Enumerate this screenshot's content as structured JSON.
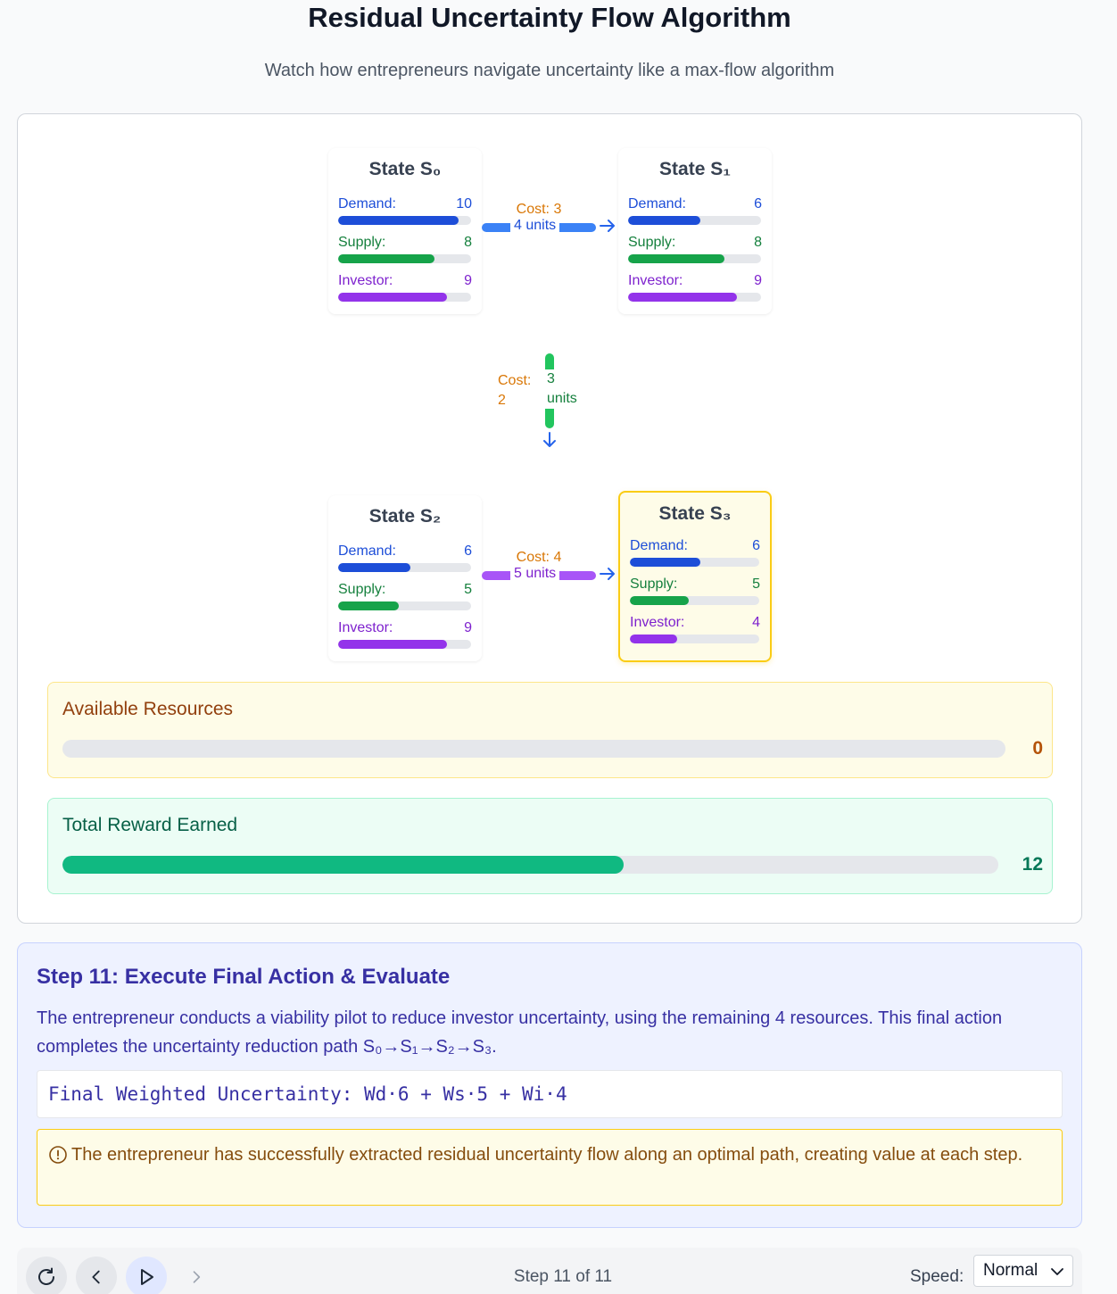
{
  "header": {
    "title": "Residual Uncertainty Flow Algorithm",
    "subtitle": "Watch how entrepreneurs navigate uncertainty like a max-flow algorithm"
  },
  "colors": {
    "demand": "#1d4ed8",
    "supply": "#16a34a",
    "investor": "#9333ea",
    "cost": "#d97706",
    "highlight": "#facc15",
    "reward": "#10b981"
  },
  "metric_max": 11,
  "states": [
    {
      "title": "State S₀",
      "demand_label": "Demand:",
      "demand": 10,
      "supply_label": "Supply:",
      "supply": 8,
      "investor_label": "Investor:",
      "investor": 9,
      "highlighted": false
    },
    {
      "title": "State S₁",
      "demand_label": "Demand:",
      "demand": 6,
      "supply_label": "Supply:",
      "supply": 8,
      "investor_label": "Investor:",
      "investor": 9,
      "highlighted": false
    },
    {
      "title": "State S₂",
      "demand_label": "Demand:",
      "demand": 6,
      "supply_label": "Supply:",
      "supply": 5,
      "investor_label": "Investor:",
      "investor": 9,
      "highlighted": false
    },
    {
      "title": "State S₃",
      "demand_label": "Demand:",
      "demand": 6,
      "supply_label": "Supply:",
      "supply": 5,
      "investor_label": "Investor:",
      "investor": 4,
      "highlighted": true
    }
  ],
  "flows": [
    {
      "from": "S₀",
      "to": "S₁",
      "cost": "Cost: 3",
      "units": "4 units",
      "color": "#3b82f6",
      "units_color": "#1d4ed8"
    },
    {
      "from": "S₁",
      "to": "S₂",
      "cost_line1": "Cost:",
      "cost_line2": "2",
      "units_line1": "3",
      "units_line2": "units",
      "color": "#22c55e",
      "units_color": "#15803d"
    },
    {
      "from": "S₂",
      "to": "S₃",
      "cost": "Cost: 4",
      "units": "5 units",
      "color": "#a855f7",
      "units_color": "#7e22ce"
    }
  ],
  "resources": {
    "available_title": "Available Resources",
    "available_value": "0",
    "available_fraction": 0,
    "reward_title": "Total Reward Earned",
    "reward_value": "12",
    "reward_fraction": 0.6
  },
  "step": {
    "title": "Step 11: Execute Final Action & Evaluate",
    "description": "The entrepreneur conducts a viability pilot to reduce investor uncertainty, using the remaining 4 resources. This final action completes the uncertainty reduction path S₀→S₁→S₂→S₃.",
    "formula": "Final Weighted Uncertainty: Wd·6 + Ws·5 + Wi·4",
    "note": "The entrepreneur has successfully extracted residual uncertainty flow along an optimal path, creating value at each step."
  },
  "controls": {
    "step_counter": "Step 11 of 11",
    "speed_label": "Speed:",
    "speed_value": "Normal"
  }
}
